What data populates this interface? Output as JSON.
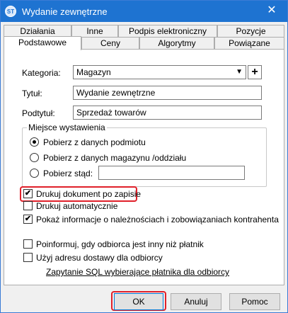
{
  "window": {
    "title": "Wydanie zewnętrzne",
    "app_icon": "app-logo-icon",
    "close_glyph": "✕"
  },
  "tabs_row1": [
    {
      "label": "Działania"
    },
    {
      "label": "Inne"
    },
    {
      "label": "Podpis elektroniczny"
    },
    {
      "label": "Pozycje"
    }
  ],
  "tabs_row2": [
    {
      "label": "Podstawowe",
      "active": true
    },
    {
      "label": "Ceny"
    },
    {
      "label": "Algorytmy"
    },
    {
      "label": "Powiązane"
    }
  ],
  "form": {
    "kategoria_label": "Kategoria:",
    "kategoria_value": "Magazyn",
    "plus_glyph": "+",
    "tytul_label": "Tytuł:",
    "tytul_value": "Wydanie zewnętrzne",
    "podtytul_label": "Podtytuł:",
    "podtytul_value": "Sprzedaż towarów"
  },
  "miejsce": {
    "group_title": "Miejsce wystawienia",
    "option1": "Pobierz z danych podmiotu",
    "option2": "Pobierz z danych magazynu /oddziału",
    "option3": "Pobierz stąd:",
    "option3_value": "",
    "selected": 1
  },
  "checks": {
    "drukuj_po_zapisie": {
      "label": "Drukuj dokument po zapisie",
      "checked": true
    },
    "drukuj_auto": {
      "label": "Drukuj automatycznie",
      "checked": false
    },
    "pokaz_info": {
      "label": "Pokaż informacje o należnościach i zobowiązaniach kontrahenta",
      "checked": true
    },
    "poinformuj": {
      "label": "Poinformuj, gdy odbiorca jest inny niż płatnik",
      "checked": false
    },
    "uzyj_adresu": {
      "label": "Użyj adresu dostawy dla odbiorcy",
      "checked": false
    }
  },
  "sql_link": "Zapytanie SQL wybierające płatnika dla odbiorcy",
  "buttons": {
    "ok": "OK",
    "cancel": "Anuluj",
    "help": "Pomoc"
  },
  "colors": {
    "titlebar": "#1e73d1",
    "highlight": "#e0202a"
  }
}
